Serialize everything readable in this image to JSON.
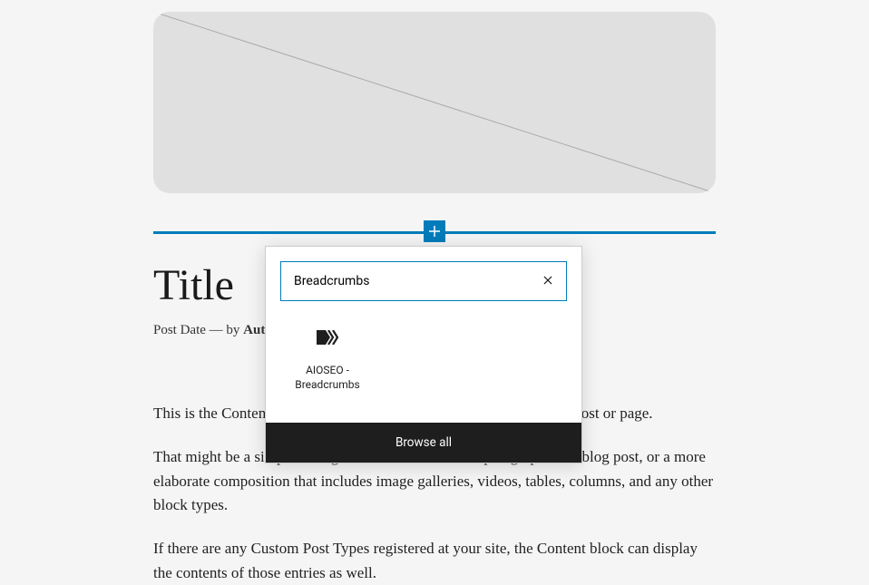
{
  "post": {
    "title": "Title",
    "meta": {
      "date_label": "Post Date",
      "separator": " — ",
      "by_label": "by ",
      "author": "Author"
    },
    "content": {
      "p1": "This is the Content block, it will display all the blocks in any single post or page.",
      "p2": "That might be a simple arrangement like consecutive paragraphs in a blog post, or a more elaborate composition that includes image galleries, videos, tables, columns, and any other block types.",
      "p3": "If there are any Custom Post Types registered at your site, the Content block can display the contents of those entries as well."
    }
  },
  "inserter": {
    "search_value": "Breadcrumbs",
    "results": [
      {
        "label": "AIOSEO - Breadcrumbs",
        "icon": "breadcrumbs-icon"
      }
    ],
    "browse_all": "Browse all"
  }
}
